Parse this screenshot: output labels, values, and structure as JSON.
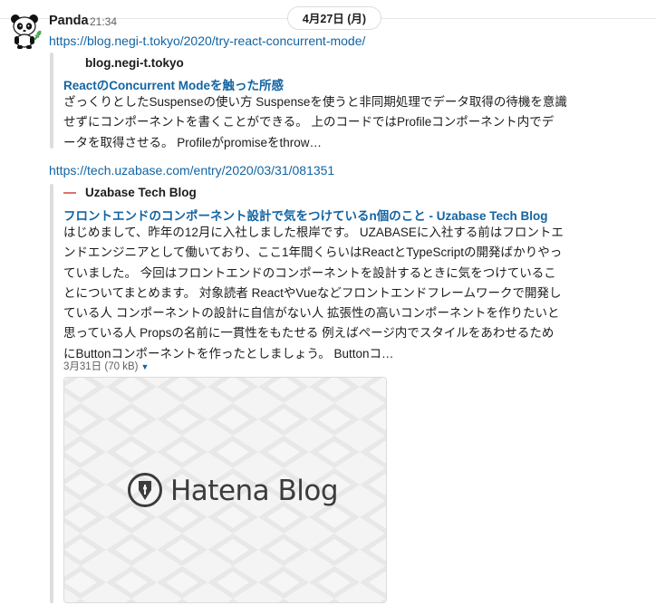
{
  "date_divider": {
    "label": "4月27日 (月)"
  },
  "message": {
    "sender": "Panda",
    "time": "21:34",
    "avatar_icon": "panda-icon"
  },
  "unfurls": [
    {
      "url": "https://blog.negi-t.tokyo/2020/try-react-concurrent-mode/",
      "service_name": "blog.negi-t.tokyo",
      "title": "ReactのConcurrent Modeを触った所感",
      "description_lines": [
        "ざっくりとしたSuspenseの使い方 Suspenseを使うと非同期処理でデータ取得の待機を意識",
        "せずにコンポーネントを書くことができる。 上のコードではProfileコンポーネント内でデ",
        "ータを取得させる。 Profileがpromiseをthrow…"
      ]
    },
    {
      "url": "https://tech.uzabase.com/entry/2020/03/31/081351",
      "service_name": "Uzabase Tech Blog",
      "service_icon": "uzabase-favicon-icon",
      "title": "フロントエンドのコンポーネント設計で気をつけているn個のこと - Uzabase Tech Blog",
      "description_lines": [
        "はじめまして、昨年の12月に入社しました根岸です。 UZABASEに入社する前はフロントエ",
        "ンドエンジニアとして働いており、ここ1年間くらいはReactとTypeScriptの開発ばかりやっ",
        "ていました。 今回はフロントエンドのコンポーネントを設計するときに気をつけているこ",
        "とについてまとめます。 対象読者 ReactやVueなどフロントエンドフレームワークで開発し",
        "ている人 コンポーネントの設計に自信がない人 拡張性の高いコンポーネントを作りたいと",
        "思っている人 Propsの名前に一貫性をもたせる 例えばページ内でスタイルをあわせるため",
        "にButtonコンポーネントを作ったとしましょう。 Buttonコ…"
      ],
      "image_meta": "3月31日 (70 kB)",
      "image_caret_icon": "caret-down-icon",
      "image_logo_icon": "hatena-pen-icon",
      "image_text": "Hatena Blog"
    }
  ]
}
